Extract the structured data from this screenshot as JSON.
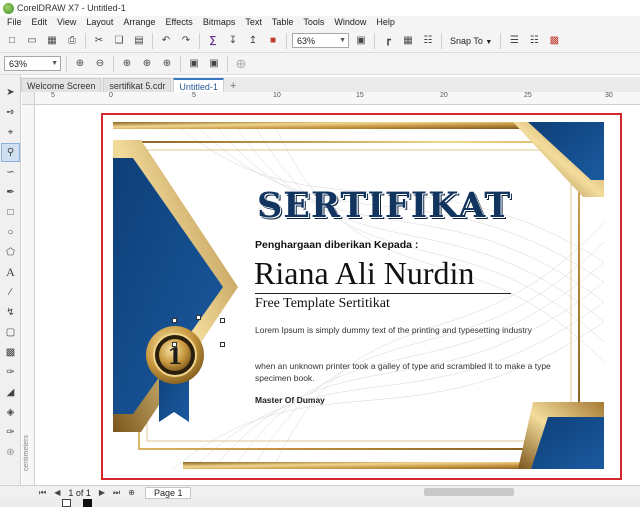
{
  "app": {
    "title": "CorelDRAW X7 - Untitled-1"
  },
  "menu": {
    "items": [
      "File",
      "Edit",
      "View",
      "Layout",
      "Arrange",
      "Effects",
      "Bitmaps",
      "Text",
      "Table",
      "Tools",
      "Window",
      "Help"
    ]
  },
  "toolbar": {
    "zoom_value": "63%",
    "snap_label": "Snap To"
  },
  "propbar": {
    "zoom_value": "63%"
  },
  "tabs": {
    "items": [
      "Welcome Screen",
      "sertifikat 5.cdr",
      "Untitled-1"
    ],
    "add": "+"
  },
  "ruler": {
    "ticks": [
      "5",
      "0",
      "5",
      "10",
      "15",
      "20",
      "25",
      "30"
    ],
    "vertical_label": "centimeters"
  },
  "certificate": {
    "heading": "SERTIFIKAT",
    "subtitle": "Penghargaan diberikan Kepada :",
    "recipient": "Riana Ali Nurdin",
    "template_line": "Free Template Sertitikat",
    "body1": "Lorem Ipsum is simply dummy text of the printing and typesetting industry",
    "body2": " when an unknown printer took a galley of type and scrambled it to make a type specimen book.",
    "signer": "Master Of Dumay",
    "medal_number": "1",
    "colors": {
      "navy": "#12447f",
      "gold": "#c9a052",
      "border": "#d3262a"
    }
  },
  "status": {
    "page_count": "1 of 1",
    "page_tab": "Page 1"
  },
  "icons": {
    "tools": [
      "pick-icon",
      "shape-icon",
      "crop-icon",
      "zoom-icon",
      "freehand-icon",
      "artistic-media-icon",
      "rectangle-icon",
      "ellipse-icon",
      "polygon-icon",
      "text-icon",
      "parallel-dimension-icon",
      "connector-icon",
      "drop-shadow-icon",
      "transparency-icon",
      "color-eyedropper-icon",
      "interactive-fill-icon",
      "smart-fill-icon",
      "outline-pen-icon"
    ]
  }
}
